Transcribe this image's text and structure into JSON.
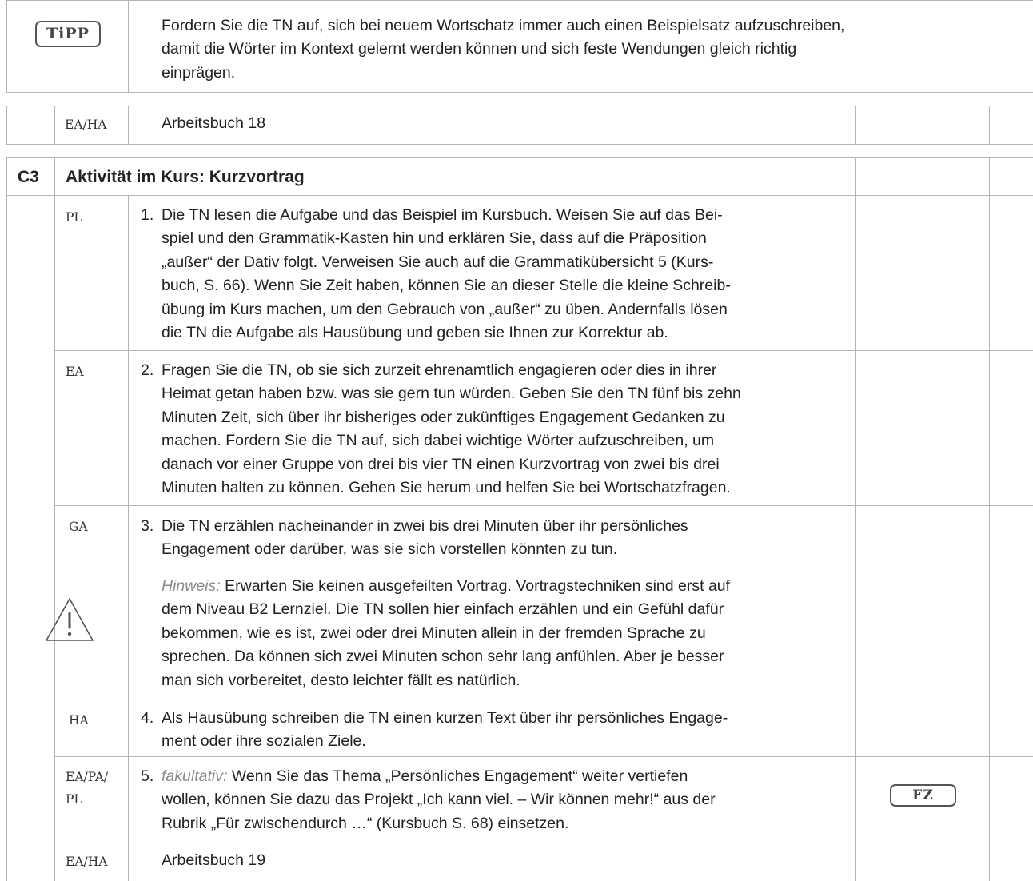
{
  "tipp": {
    "badge": "TiPP",
    "lines": [
      "Fordern Sie die TN auf, sich bei neuem Wortschatz immer auch einen Beispielsatz aufzuschreiben,",
      "damit die Wörter im Kontext gelernt werden können und sich feste Wendungen gleich richtig",
      "einprägen."
    ]
  },
  "row_ab18": {
    "form": "EA/HA",
    "text": "Arbeitsbuch 18"
  },
  "section": {
    "code": "C3",
    "title": "Aktivität im Kurs: Kurzvortrag"
  },
  "steps": [
    {
      "form": "PL",
      "num": "1.",
      "lines": [
        "Die TN lesen die Aufgabe und das Beispiel im Kursbuch. Weisen Sie auf das Bei-",
        "spiel und den Grammatik-Kasten hin und erklären Sie, dass auf die Präposition",
        "„außer“ der Dativ folgt. Verweisen Sie auch auf die Grammatikübersicht 5 (Kurs-",
        "buch, S. 66). Wenn Sie Zeit haben, können Sie an dieser Stelle die kleine Schreib-",
        "übung im Kurs machen, um den Gebrauch von „außer“ zu üben. Andernfalls lösen",
        "die TN die Aufgabe als Hausübung und geben sie Ihnen zur Korrektur ab."
      ]
    },
    {
      "form": "EA",
      "num": "2.",
      "lines": [
        "Fragen Sie die TN, ob sie sich zurzeit ehrenamtlich engagieren oder dies in ihrer",
        "Heimat getan haben bzw. was sie gern tun würden. Geben Sie den TN fünf bis zehn",
        "Minuten Zeit, sich über ihr bisheriges oder zukünftiges Engagement Gedanken zu",
        "machen. Fordern Sie die TN auf, sich dabei wichtige Wörter aufzuschreiben, um",
        "danach vor einer Gruppe von drei bis vier TN einen Kurzvortrag von zwei bis drei",
        "Minuten halten zu können. Gehen Sie herum und helfen Sie bei Wortschatzfragen."
      ]
    },
    {
      "form": "GA",
      "num": "3.",
      "lines": [
        "Die TN erzählen nacheinander in zwei bis drei Minuten über ihr persönliches",
        "Engagement oder darüber, was sie sich vorstellen könnten zu tun."
      ],
      "note_label": "Hinweis:",
      "note_first": "Erwarten Sie keinen ausgefeilten Vortrag. Vortragstechniken sind erst auf",
      "note_lines": [
        "dem Niveau B2 Lernziel. Die TN sollen hier einfach erzählen und ein Gefühl dafür",
        "bekommen, wie es ist, zwei oder drei Minuten allein in der fremden Sprache zu",
        "sprechen. Da können sich zwei Minuten schon sehr lang anfühlen. Aber je besser",
        "man sich vorbereitet, desto leichter fällt es natürlich."
      ]
    },
    {
      "form": "HA",
      "num": "4.",
      "lines": [
        "Als Hausübung schreiben die TN einen kurzen Text über ihr persönliches Engage-",
        "ment oder ihre sozialen Ziele."
      ]
    },
    {
      "form_lines": [
        "EA/PA/",
        "PL"
      ],
      "num": "5.",
      "label": "fakultativ:",
      "first": "Wenn Sie das Thema „Persönliches Engagement“ weiter vertiefen",
      "lines": [
        "wollen, können Sie dazu das Projekt „Ich kann viel. – Wir können mehr!“ aus der",
        "Rubrik „Für zwischendurch …“ (Kursbuch S. 68) einsetzen."
      ],
      "badge": "FZ"
    }
  ],
  "row_ab19": {
    "form": "EA/HA",
    "text": "Arbeitsbuch 19"
  }
}
